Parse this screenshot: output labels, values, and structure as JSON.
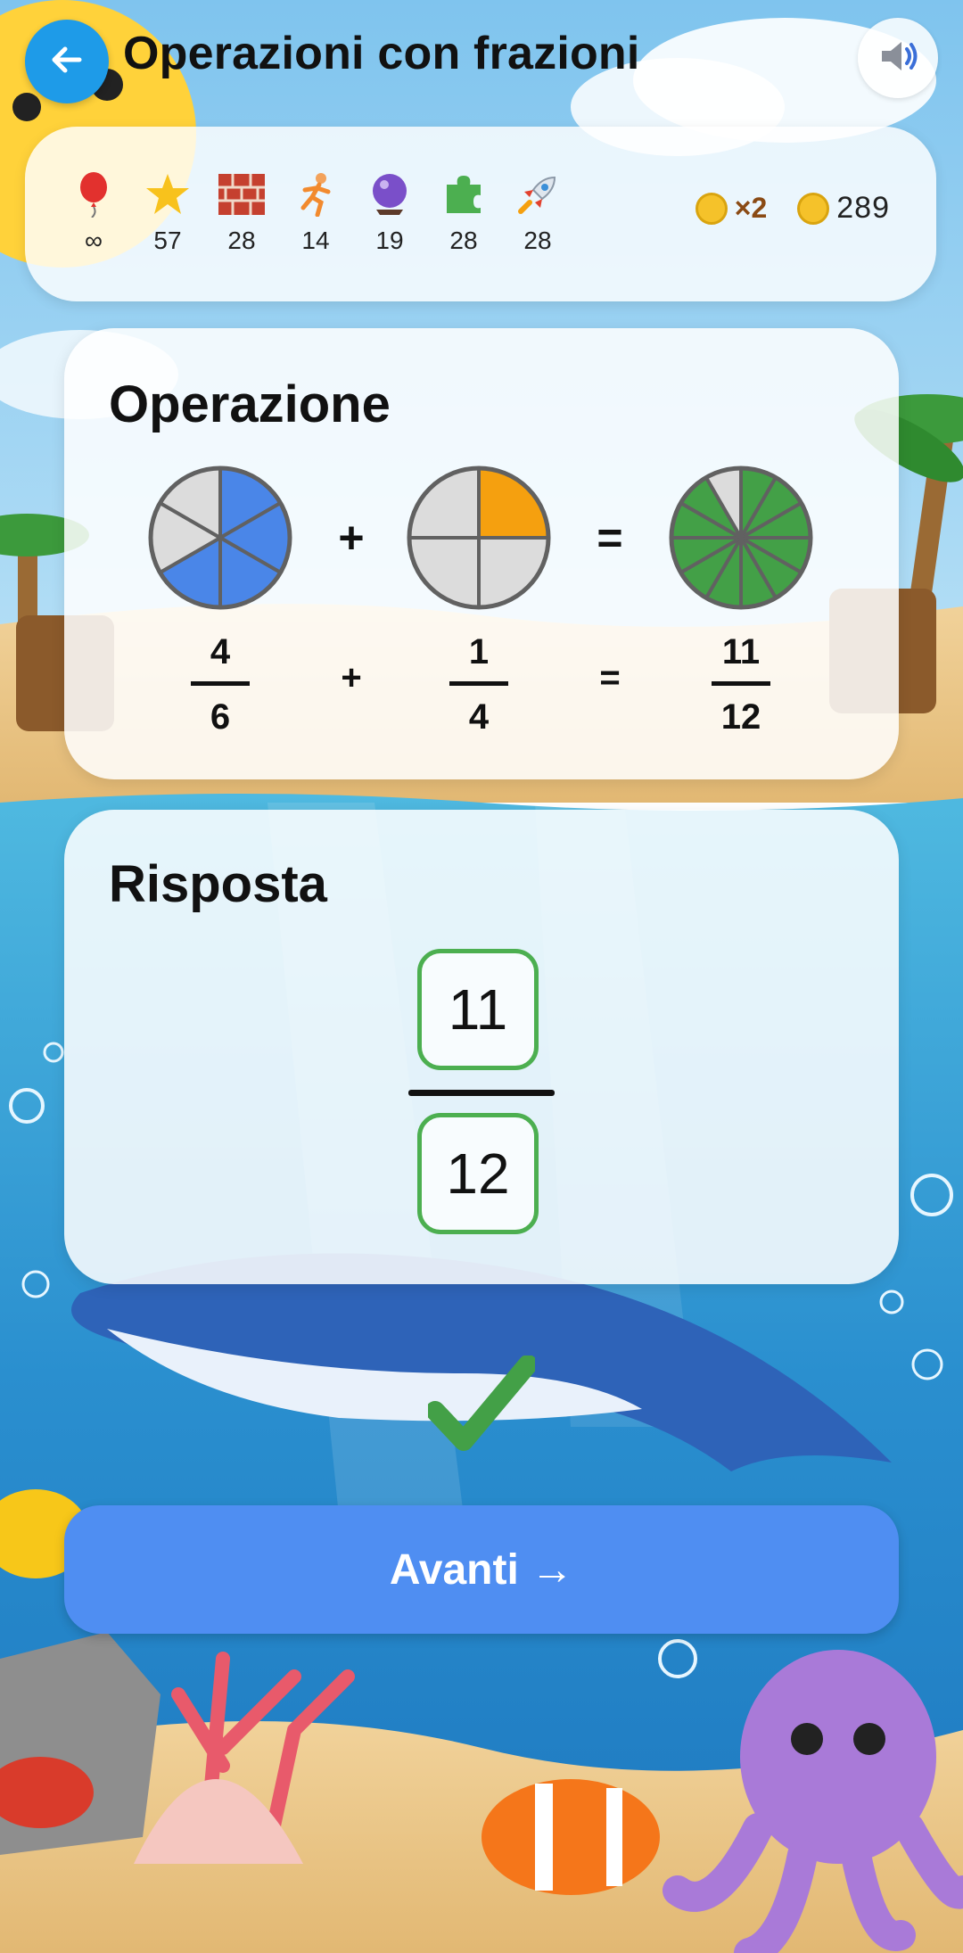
{
  "header": {
    "title": "Operazioni con frazioni",
    "back_icon": "arrow-left-icon",
    "sound_icon": "speaker-icon"
  },
  "stats": {
    "items": [
      {
        "icon": "balloon-icon",
        "value": "∞"
      },
      {
        "icon": "star-icon",
        "value": "57"
      },
      {
        "icon": "brick-icon",
        "value": "28"
      },
      {
        "icon": "runner-icon",
        "value": "14"
      },
      {
        "icon": "crystal-ball-icon",
        "value": "19"
      },
      {
        "icon": "puzzle-icon",
        "value": "28"
      },
      {
        "icon": "rocket-icon",
        "value": "28"
      }
    ],
    "multiplier": "×2",
    "coins_total": "289"
  },
  "operation": {
    "title": "Operazione",
    "operand1": {
      "numerator": "4",
      "denominator": "6",
      "color": "#4a86e8"
    },
    "operator": "+",
    "operand2": {
      "numerator": "1",
      "denominator": "4",
      "color": "#f5a00f"
    },
    "equals": "=",
    "result": {
      "numerator": "11",
      "denominator": "12",
      "color": "#43a047"
    }
  },
  "answer": {
    "title": "Risposta",
    "numerator": "11",
    "denominator": "12",
    "correct_color": "#4caf50"
  },
  "feedback": {
    "icon": "checkmark-icon",
    "color": "#43a047"
  },
  "next_button": {
    "label": "Avanti →"
  }
}
